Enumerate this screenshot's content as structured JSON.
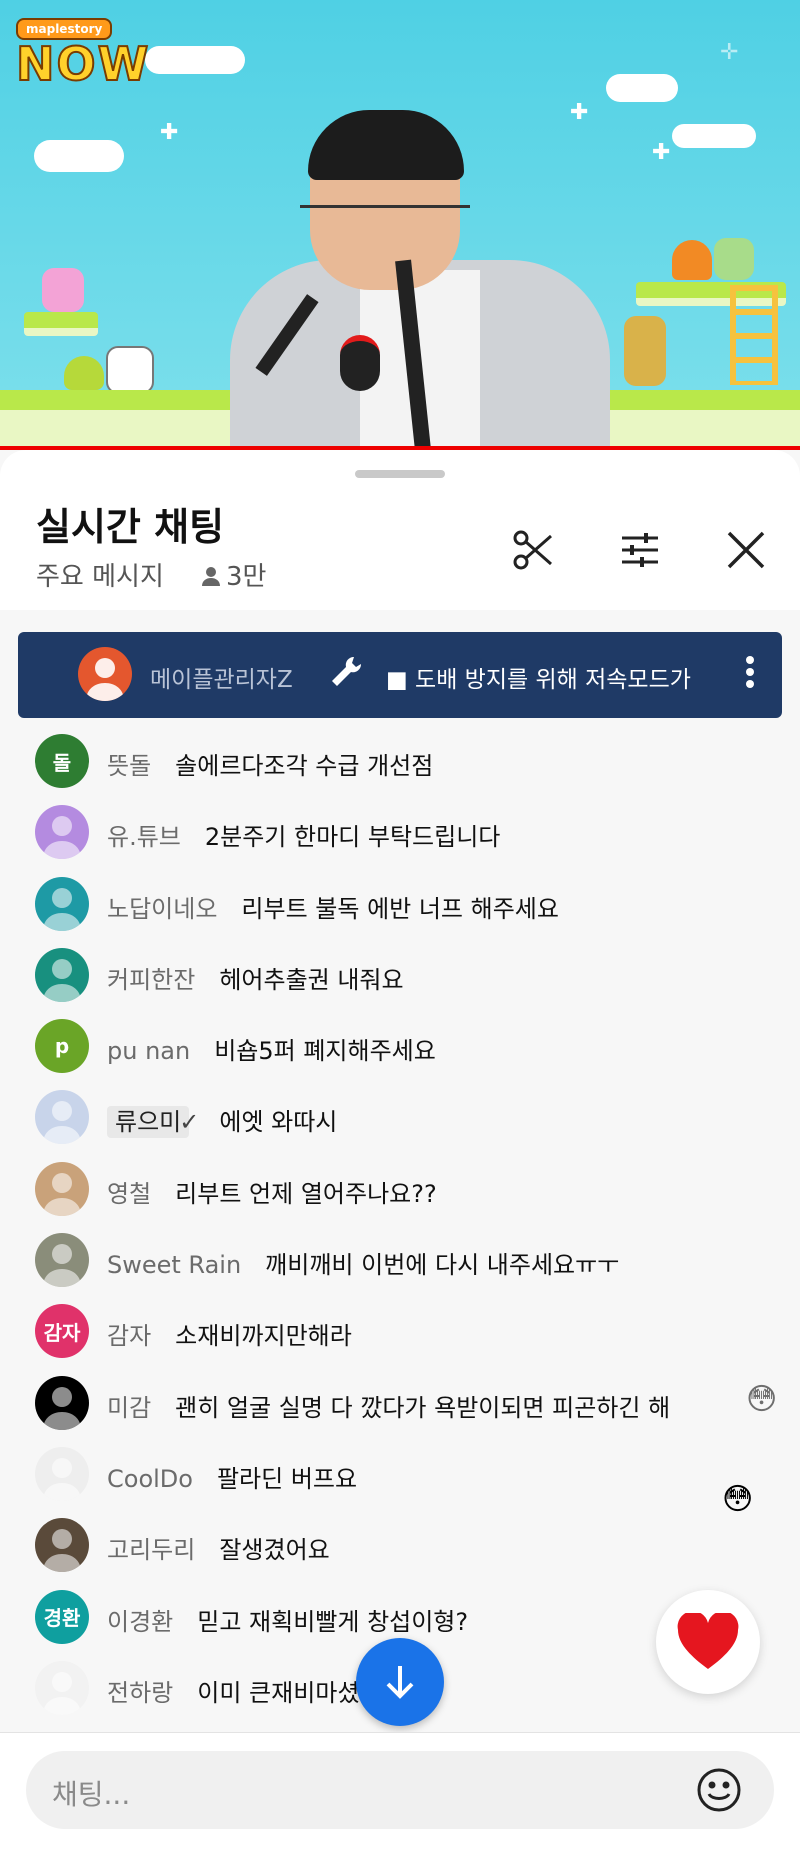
{
  "video": {
    "logo_small": "maplestory",
    "logo_big": "NOW"
  },
  "chat": {
    "title": "실시간 채팅",
    "mode": "주요 메시지",
    "viewers": "3만"
  },
  "pinned": {
    "author": "메이플관리자Z",
    "message": "■ 도배 방지를 위해 저속모드가"
  },
  "messages": [
    {
      "avatar_text": "돌",
      "avatar_color": "#2e7d32",
      "name": "뜻돌",
      "text": "솔에르다조각 수급 개선점"
    },
    {
      "avatar_text": "",
      "avatar_color": "#b48be0",
      "name": "유.튜브",
      "text": "2분주기 한마디 부탁드립니다"
    },
    {
      "avatar_text": "",
      "avatar_color": "#1e9aa5",
      "name": "노답이네오",
      "text": "리부트 불독 에반 너프 해주세요"
    },
    {
      "avatar_text": "",
      "avatar_color": "#18907f",
      "name": "커피한잔",
      "text": "헤어추출권 내줘요"
    },
    {
      "avatar_text": "p",
      "avatar_color": "#6aa527",
      "name": "pu nan",
      "text": "비숍5퍼 폐지해주세요"
    },
    {
      "avatar_text": "",
      "avatar_color": "#c8d4ea",
      "name": "류으미",
      "badge": true,
      "text": "에엣 와따시"
    },
    {
      "avatar_text": "",
      "avatar_color": "#c9a27a",
      "name": "영철",
      "text": "리부트 언제 열어주나요??"
    },
    {
      "avatar_text": "",
      "avatar_color": "#8a8d7a",
      "name": "Sweet Rain",
      "text": "깨비깨비 이번에 다시 내주세요ㅠㅜ"
    },
    {
      "avatar_text": "감자",
      "avatar_color": "#e0326a",
      "name": "감자",
      "text": "소재비까지만해라"
    },
    {
      "avatar_text": "",
      "avatar_color": "#000000",
      "name": "미감",
      "text": "괜히 얼굴 실명 다 깠다가 욕받이되면 피곤하긴 해"
    },
    {
      "avatar_text": "",
      "avatar_color": "#eeeeee",
      "name": "CoolDo",
      "text": "팔라딘 버프요"
    },
    {
      "avatar_text": "",
      "avatar_color": "#5a4a3a",
      "name": "고리두리",
      "text": "잘생겼어요"
    },
    {
      "avatar_text": "경환",
      "avatar_color": "#0f9f9f",
      "name": "이경환",
      "text": "믿고 재획비빨게 창섭이형?"
    },
    {
      "avatar_text": "",
      "avatar_color": "#f2f2f2",
      "name": "전하랑",
      "text": "이미 큰재비마셨"
    }
  ],
  "input": {
    "placeholder": "채팅..."
  },
  "colors": {
    "accent_blue": "#1a73e8",
    "pinned_bg": "#1f3a66",
    "live_red": "#e00000"
  },
  "icons": [
    "scissors-icon",
    "tune-icon",
    "close-icon",
    "wrench-icon",
    "more-vert-icon",
    "arrow-down-icon",
    "heart-icon",
    "emoji-icon",
    "person-icon"
  ]
}
